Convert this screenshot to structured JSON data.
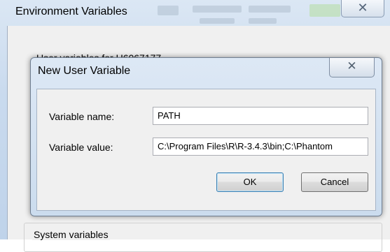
{
  "parent_window": {
    "title": "Environment Variables",
    "user_variables_label": "User variables for U6067177",
    "system_variables_label": "System variables",
    "close_glyph": "✕"
  },
  "dialog": {
    "title": "New User Variable",
    "close_glyph": "✕",
    "fields": {
      "name_label": "Variable name:",
      "name_value": "PATH",
      "value_label": "Variable value:",
      "value_value": "C:\\Program Files\\R\\R-3.4.3\\bin;C:\\Phantom"
    },
    "buttons": {
      "ok": "OK",
      "cancel": "Cancel"
    }
  },
  "colors": {
    "title_bar": "#cbdcee",
    "client_bg": "#f0f0f0",
    "default_button_border": "#3c7fb1"
  }
}
